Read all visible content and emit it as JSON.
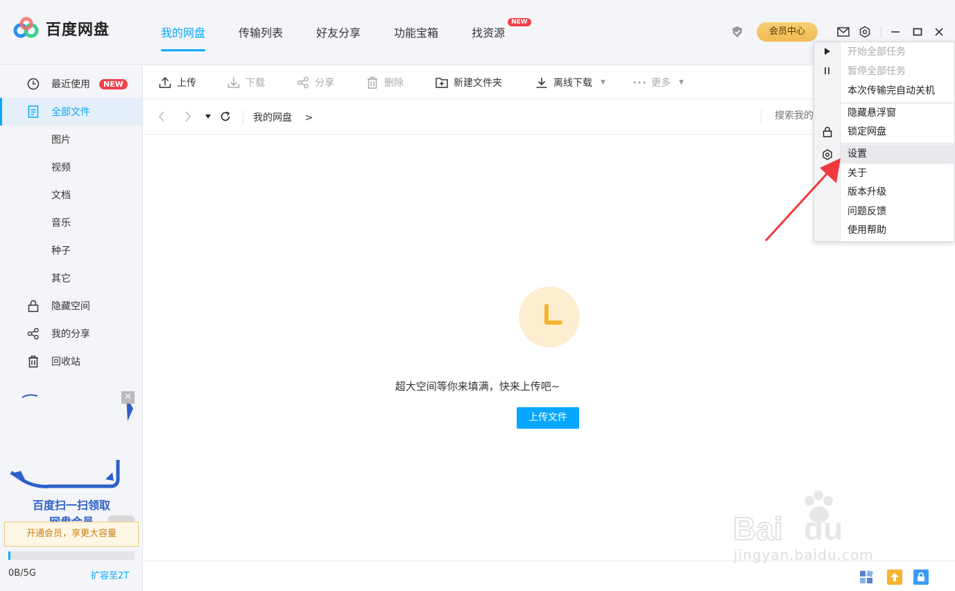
{
  "app": {
    "logo_text": "百度网盘",
    "logo_colors": [
      "#2a8df3",
      "#f56c6c",
      "#3ecf8e"
    ]
  },
  "nav": {
    "tabs": [
      {
        "label": "我的网盘",
        "active": true
      },
      {
        "label": "传输列表"
      },
      {
        "label": "好友分享"
      },
      {
        "label": "功能宝箱"
      },
      {
        "label": "找资源",
        "badge": "NEW"
      }
    ]
  },
  "titlebar": {
    "vip_label": "会员中心"
  },
  "sidebar": {
    "items": [
      {
        "label": "最近使用",
        "icon": "clock-icon",
        "badge": "NEW"
      },
      {
        "label": "全部文件",
        "icon": "file-icon",
        "active": true
      },
      {
        "label": "图片"
      },
      {
        "label": "视频"
      },
      {
        "label": "文档"
      },
      {
        "label": "音乐"
      },
      {
        "label": "种子"
      },
      {
        "label": "其它"
      },
      {
        "label": "隐藏空间",
        "icon": "lock-icon"
      },
      {
        "label": "我的分享",
        "icon": "share-icon"
      },
      {
        "label": "回收站",
        "icon": "trash-icon"
      }
    ],
    "promo_line1": "百度扫一扫领取",
    "promo_line2": "网盘会员",
    "upsell": "开通会员，享更大容量",
    "quota": "0B/5G",
    "expand": "扩容至2T"
  },
  "toolbar": {
    "upload": "上传",
    "download": "下载",
    "share": "分享",
    "delete": "删除",
    "new_folder": "新建文件夹",
    "offline": "离线下载",
    "more": "更多"
  },
  "pathbar": {
    "crumb": "我的网盘",
    "crumb_sep": ">",
    "search_placeholder": "搜索我的"
  },
  "empty": {
    "message": "超大空间等你来填满，快来上传吧~",
    "button": "上传文件"
  },
  "menu": {
    "items": [
      {
        "label": "开始全部任务",
        "disabled": true
      },
      {
        "label": "暂停全部任务",
        "disabled": true
      },
      {
        "label": "本次传输完自动关机"
      },
      {
        "label": "隐藏悬浮窗"
      },
      {
        "label": "锁定网盘"
      },
      {
        "label": "设置",
        "hover": true
      },
      {
        "label": "关于"
      },
      {
        "label": "版本升级"
      },
      {
        "label": "问题反馈"
      },
      {
        "label": "使用帮助"
      }
    ]
  },
  "watermark": {
    "text": "jingyan.baidu.com"
  },
  "colors": {
    "accent": "#06a7ff",
    "badge": "#f2404b",
    "vip": "#f1bb52",
    "arrow": "#f0393c"
  }
}
